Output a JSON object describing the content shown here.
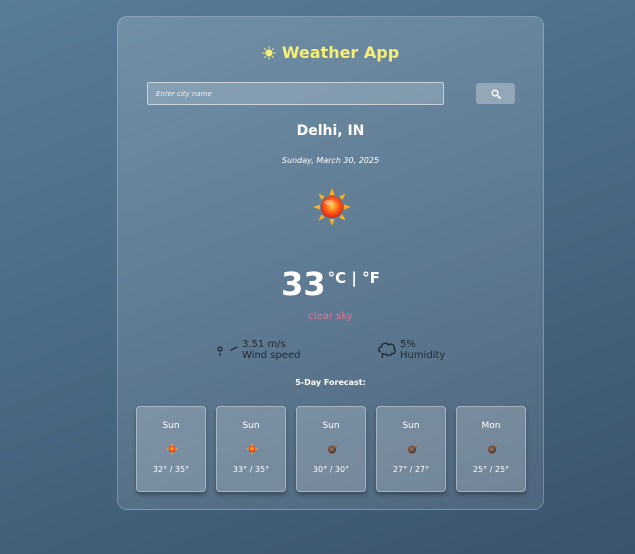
{
  "app": {
    "title": "Weather App",
    "title_color": "#f6ee76"
  },
  "search": {
    "placeholder": "Enter city name",
    "value": "",
    "button_icon": "search-icon"
  },
  "current": {
    "city": "Delhi, IN",
    "date": "Sunday, March 30, 2025",
    "icon": "sun-icon",
    "temperature": "33",
    "units": "°C | °F",
    "description": "clear sky",
    "description_color": "#e0738f"
  },
  "stats": {
    "wind": {
      "value": "3.51 m/s",
      "label": "Wind speed",
      "icon": "wind-icon"
    },
    "humidity": {
      "value": "5%",
      "label": "Humidity",
      "icon": "humidity-icon"
    }
  },
  "forecast": {
    "title": "5-Day Forecast:",
    "days": [
      {
        "day": "Sun",
        "icon": "sun-icon",
        "temps": "32° / 35°"
      },
      {
        "day": "Sun",
        "icon": "sun-icon",
        "temps": "33° / 35°"
      },
      {
        "day": "Sun",
        "icon": "cloud-icon",
        "temps": "30° / 30°"
      },
      {
        "day": "Sun",
        "icon": "cloud-icon",
        "temps": "27° / 27°"
      },
      {
        "day": "Mon",
        "icon": "cloud-icon",
        "temps": "25° / 25°"
      }
    ]
  }
}
